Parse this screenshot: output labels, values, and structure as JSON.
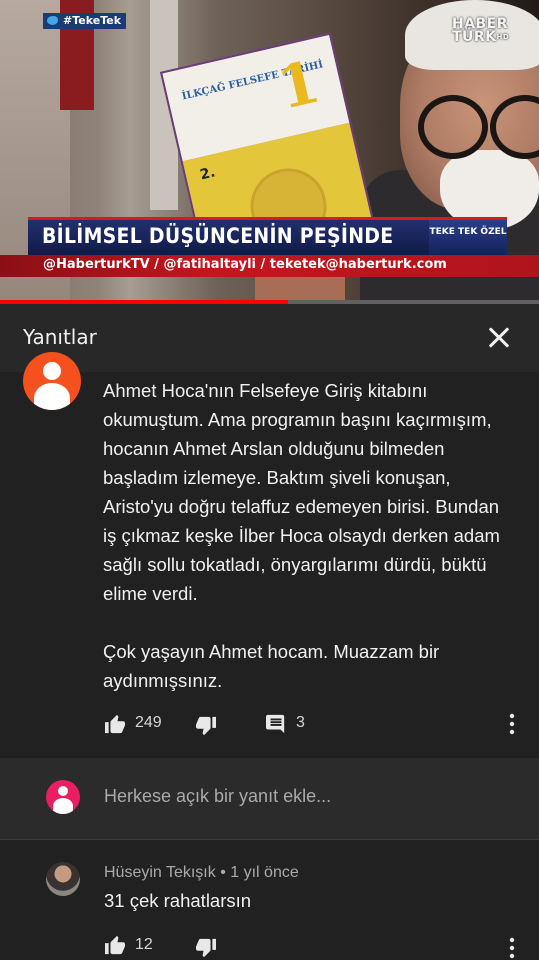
{
  "video": {
    "hashtag": "#TekeTek",
    "channel_logo": "HABER TÜRK",
    "channel_hd": "HD",
    "book_series_number": "1",
    "book_title": "İLKÇAĞ FELSEFE TARİHİ",
    "book_edition": "2.",
    "banner_title": "BİLİMSEL DÜŞÜNCENİN PEŞİNDE",
    "badge_text": "TEKE TEK ÖZEL",
    "ticker_text": "@HaberturkTV / @fatihaltayli / teketek@haberturk.com",
    "progress_fraction": 0.535,
    "progress_color": "#ff0000"
  },
  "panel": {
    "title": "Yanıtlar",
    "close_icon": "close-icon"
  },
  "comment": {
    "avatar_color": "#f4511e",
    "text": "Ahmet Hoca'nın Felsefeye Giriş kitabını okumuştum. Ama programın başını kaçırmışım, hocanın Ahmet Arslan olduğunu bilmeden başladım izlemeye. Baktım şiveli konuşan, Aristo'yu doğru telaffuz edemeyen birisi. Bundan iş çıkmaz keşke İlber Hoca olsaydı derken adam sağlı sollu tokatladı, önyargılarımı dürdü, büktü elime verdi.\n\nÇok yaşayın Ahmet hocam. Muazzam bir aydınmışsınız.",
    "like_count": "249",
    "reply_count": "3",
    "icons": [
      "thumbs-up-icon",
      "thumbs-down-icon",
      "reply-icon",
      "more-vert-icon"
    ]
  },
  "reply_input": {
    "avatar_color": "#e91e63",
    "placeholder": "Herkese açık bir yanıt ekle..."
  },
  "replies": [
    {
      "author": "Hüseyin Tekışık",
      "separator": "•",
      "time": "1 yıl önce",
      "text": "31 çek rahatlarsın",
      "like_count": "12"
    }
  ]
}
